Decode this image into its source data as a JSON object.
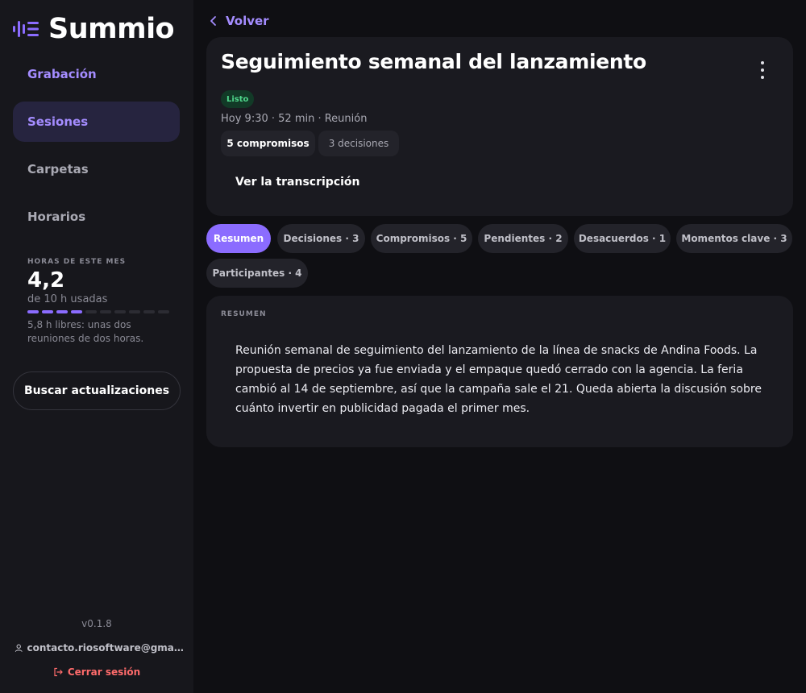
{
  "app": {
    "name": "Summio"
  },
  "sidebar": {
    "items": [
      {
        "label": "Grabación"
      },
      {
        "label": "Sesiones"
      },
      {
        "label": "Carpetas"
      },
      {
        "label": "Horarios"
      }
    ],
    "hours": {
      "title": "HORAS DE ESTE MES",
      "value": "4,2",
      "used_label": "de 10 h usadas",
      "used_fraction": 0.42,
      "note": "5,8 h libres: unas dos reuniones de dos horas."
    },
    "update_button": "Buscar actualizaciones",
    "version": "v0.1.8",
    "user_email": "contacto.riosoftware@gmail.com",
    "logout": "Cerrar sesión"
  },
  "header": {
    "back": "Volver",
    "title": "Seguimiento semanal del lanzamiento",
    "status": "Listo",
    "meta": "Hoy 9:30 · 52 min · Reunión",
    "chips": [
      "5 compromisos",
      "3 decisiones"
    ],
    "transcript_link": "Ver la transcripción"
  },
  "tabs": [
    {
      "label": "Resumen"
    },
    {
      "label": "Decisiones · 3"
    },
    {
      "label": "Compromisos · 5"
    },
    {
      "label": "Pendientes · 2"
    },
    {
      "label": "Desacuerdos · 1"
    },
    {
      "label": "Momentos clave · 3"
    },
    {
      "label": "Participantes · 4"
    }
  ],
  "summary": {
    "label": "RESUMEN",
    "text": "Reunión semanal de seguimiento del lanzamiento de la línea de snacks de Andina Foods. La propuesta de precios ya fue enviada y el empaque quedó cerrado con la agencia. La feria cambió al 14 de septiembre, así que la campaña sale el 21. Queda abierta la discusión sobre cuánto invertir en publicidad pagada el primer mes."
  },
  "colors": {
    "accent": "#8b6cff",
    "accent_text": "#a48cff",
    "status_green": "#4fd68b",
    "danger": "#ff6b6b"
  }
}
